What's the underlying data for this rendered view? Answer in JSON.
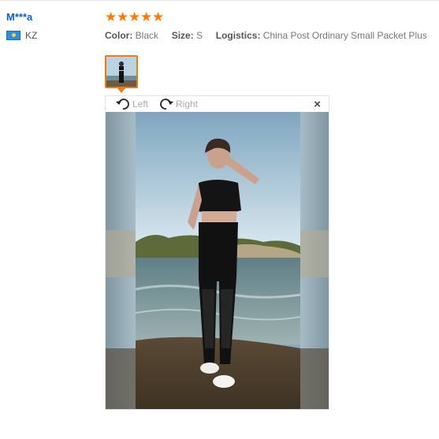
{
  "reviewer": {
    "name": "M***a",
    "country": "KZ"
  },
  "review": {
    "rating": 5,
    "color_label": "Color:",
    "color_value": "Black",
    "size_label": "Size:",
    "size_value": "S",
    "logistics_label": "Logistics:",
    "logistics_value": "China Post Ordinary Small Packet Plus"
  },
  "viewer": {
    "rotate_left_label": "Left",
    "rotate_right_label": "Right",
    "close_symbol": "×"
  },
  "icons": {
    "flag": "kazakhstan-flag-icon",
    "rotate_left": "rotate-left-icon",
    "rotate_right": "rotate-right-icon",
    "close": "close-icon",
    "star": "star-icon"
  },
  "colors": {
    "accent": "#f27a12",
    "star": "#ff7a00",
    "link": "#0b5fd6"
  }
}
